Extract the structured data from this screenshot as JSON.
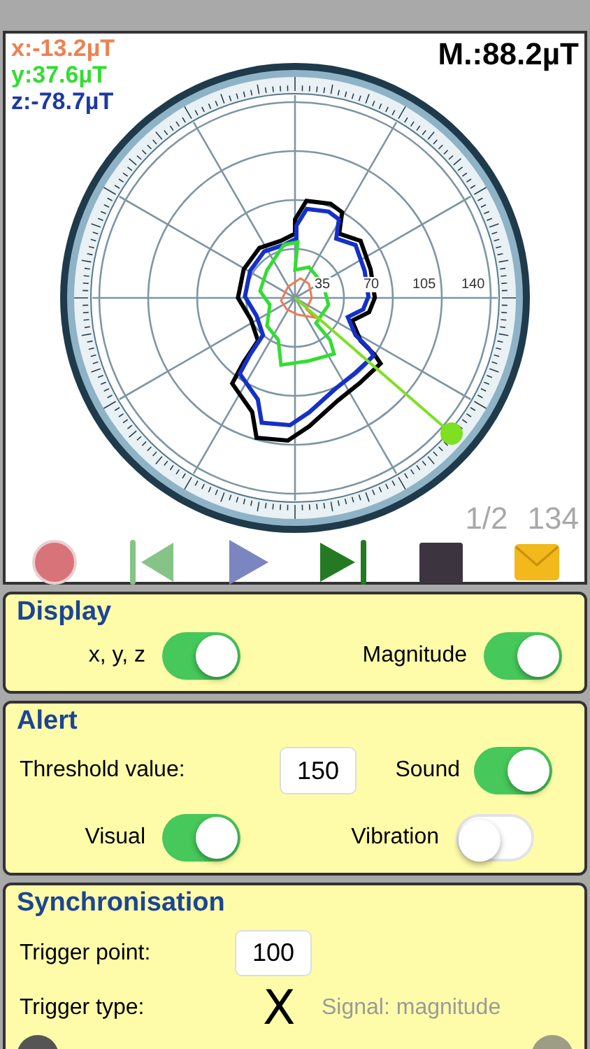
{
  "readouts": {
    "x": "x:-13.2µT",
    "y": "y:37.6µT",
    "z": "z:-78.7µT",
    "magnitude": "M.:88.2µT"
  },
  "radial_labels": [
    "35",
    "70",
    "105",
    "140"
  ],
  "counter": {
    "page": "1/2",
    "count": "134"
  },
  "toolbar": [
    {
      "kind": "record"
    },
    {
      "kind": "previous"
    },
    {
      "kind": "play"
    },
    {
      "kind": "next"
    },
    {
      "kind": "stop"
    },
    {
      "kind": "mail"
    }
  ],
  "display": {
    "title": "Display",
    "toggles": [
      {
        "label": "x, y, z",
        "on": true
      },
      {
        "label": "Magnitude",
        "on": true
      }
    ]
  },
  "alert": {
    "title": "Alert",
    "threshold": {
      "label": "Threshold value:",
      "value": "150"
    },
    "toggles": [
      {
        "label": "Sound",
        "on": true
      },
      {
        "label": "Visual",
        "on": true
      },
      {
        "label": "Vibration",
        "on": false
      }
    ]
  },
  "sync": {
    "title": "Synchronisation",
    "trigger_point": {
      "label": "Trigger point:",
      "value": "100"
    },
    "trigger_type": {
      "label": "Trigger type:",
      "symbol": "X",
      "signal": "Signal: magnitude"
    }
  }
}
